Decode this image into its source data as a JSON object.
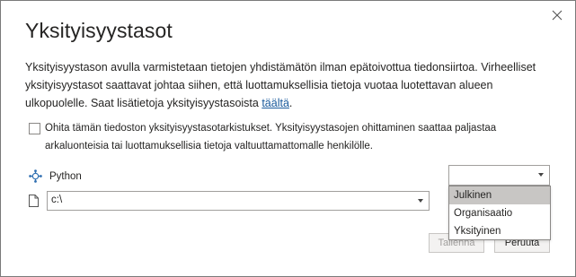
{
  "dialog": {
    "title": "Yksityisyystasot",
    "close_icon": "close-icon",
    "description_prefix": "Yksityisyystason avulla varmistetaan tietojen yhdistämätön ilman epätoivottua tiedonsiirtoa. Virheelliset yksityisyystasot saattavat johtaa siihen, että luottamuksellisia tietoja vuotaa luotettavan alueen ulkopuolelle. Saat lisätietoja yksityisyystasoista ",
    "description_link": "täältä",
    "description_suffix": "."
  },
  "ignore_check": {
    "checked": false,
    "label": "Ohita tämän tiedoston yksityisyystasotarkistukset. Yksityisyystasojen ohittaminen saattaa paljastaa arkaluonteisia tai luottamuksellisia tietoja valtuuttamattomalle henkilölle."
  },
  "source": {
    "icon": "python-icon",
    "name": "Python",
    "file_icon": "file-icon",
    "path_value": "c:\\"
  },
  "privacy_level": {
    "value": "",
    "options": [
      "Julkinen",
      "Organisaatio",
      "Yksityinen"
    ],
    "highlighted": "Julkinen"
  },
  "buttons": {
    "save": "Tallenna",
    "cancel": "Peruuta"
  }
}
